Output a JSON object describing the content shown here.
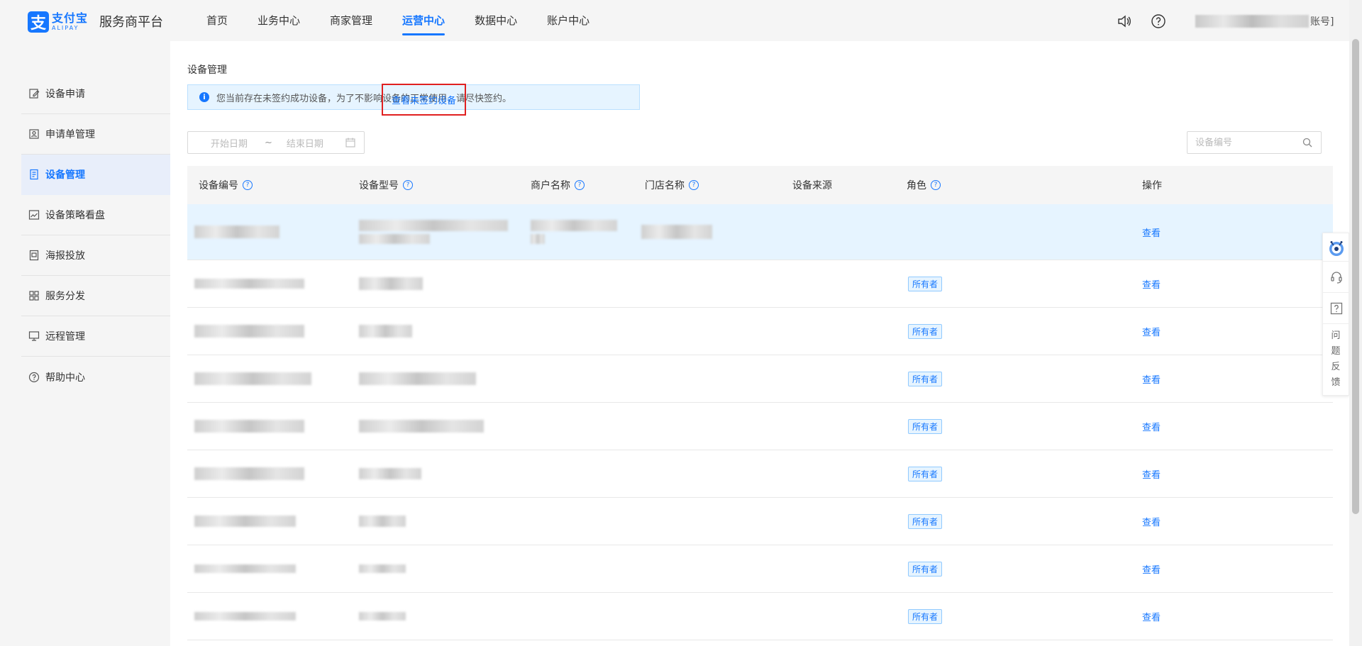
{
  "header": {
    "logo_cn": "支付宝",
    "logo_en": "ALIPAY",
    "platform": "服务商平台",
    "nav": [
      "首页",
      "业务中心",
      "商家管理",
      "运营中心",
      "数据中心",
      "账户中心"
    ],
    "active_nav": "运营中心",
    "account_suffix": "账号]"
  },
  "sidebar": {
    "items": [
      {
        "label": "设备申请",
        "icon": "edit-icon"
      },
      {
        "label": "申请单管理",
        "icon": "form-icon"
      },
      {
        "label": "设备管理",
        "icon": "device-icon"
      },
      {
        "label": "设备策略看盘",
        "icon": "chart-icon"
      },
      {
        "label": "海报投放",
        "icon": "poster-icon"
      },
      {
        "label": "服务分发",
        "icon": "grid-icon"
      },
      {
        "label": "远程管理",
        "icon": "monitor-icon"
      },
      {
        "label": "帮助中心",
        "icon": "help-circle-icon"
      }
    ],
    "active": "设备管理"
  },
  "main": {
    "title": "设备管理",
    "alert": {
      "text": "您当前存在未签约成功设备，为了不影响设备的正常使用，请尽快签约。",
      "link": "查看未签约设备"
    },
    "date_start_placeholder": "开始日期",
    "date_sep": "~",
    "date_end_placeholder": "结束日期",
    "search_placeholder": "设备编号"
  },
  "table": {
    "columns": [
      "设备编号",
      "设备型号",
      "商户名称",
      "门店名称",
      "设备来源",
      "角色",
      "操作"
    ],
    "role_tag": "所有者",
    "action": "查看"
  },
  "float": {
    "feedback": [
      "问",
      "题",
      "反",
      "馈"
    ]
  },
  "colors": {
    "primary": "#1677ff",
    "highlight_box": "#e02020",
    "alert_bg": "#e6f4ff"
  }
}
